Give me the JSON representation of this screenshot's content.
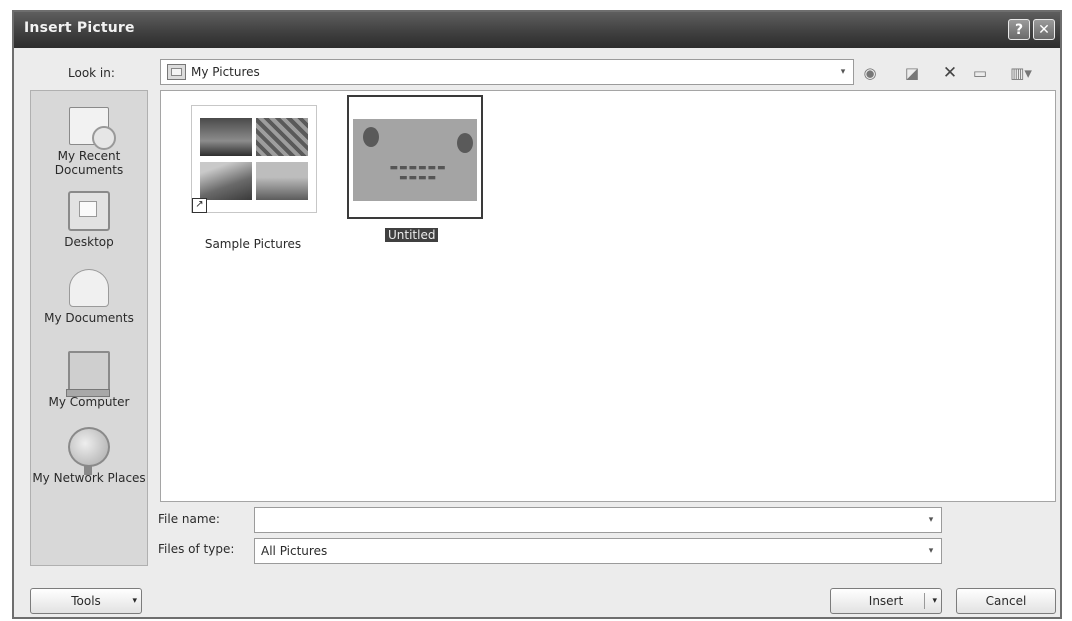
{
  "window": {
    "title": "Insert Picture",
    "help_glyph": "?",
    "close_glyph": "✕"
  },
  "look_in": {
    "label": "Look in:",
    "value": "My Pictures",
    "arrow": "▾"
  },
  "toolbar": {
    "back_glyph": "◉",
    "up_glyph": "◪",
    "delete_glyph": "✕",
    "new_folder_glyph": "▭",
    "views_glyph": "▥▾"
  },
  "places": [
    {
      "label": "My Recent Documents",
      "icon": "recent-documents-icon"
    },
    {
      "label": "Desktop",
      "icon": "desktop-icon"
    },
    {
      "label": "My Documents",
      "icon": "my-documents-icon"
    },
    {
      "label": "My Computer",
      "icon": "my-computer-icon"
    },
    {
      "label": "My Network Places",
      "icon": "network-places-icon"
    }
  ],
  "files": [
    {
      "name": "Sample Pictures",
      "type": "folder-shortcut"
    },
    {
      "name": "Untitled",
      "type": "image",
      "selected": true
    }
  ],
  "file_name": {
    "label": "File name:",
    "value": "",
    "arrow": "▾"
  },
  "files_of_type": {
    "label": "Files of type:",
    "value": "All Pictures",
    "arrow": "▾"
  },
  "buttons": {
    "tools": "Tools",
    "insert": "Insert",
    "cancel": "Cancel",
    "dropdown": "▾"
  }
}
